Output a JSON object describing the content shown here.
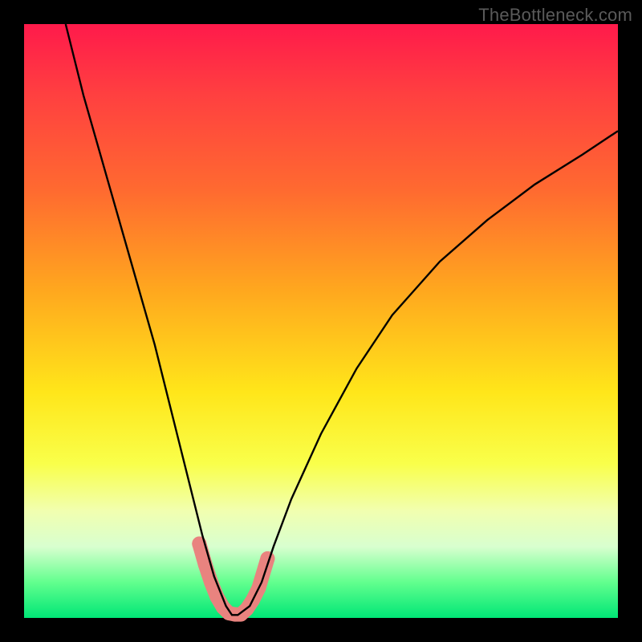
{
  "watermark": "TheBottleneck.com",
  "chart_data": {
    "type": "line",
    "title": "",
    "xlabel": "",
    "ylabel": "",
    "xlim": [
      0,
      100
    ],
    "ylim": [
      0,
      100
    ],
    "series": [
      {
        "name": "bottleneck-curve",
        "x": [
          7,
          10,
          14,
          18,
          22,
          26,
          28,
          30,
          32,
          34,
          35,
          36,
          38,
          40,
          42,
          45,
          50,
          56,
          62,
          70,
          78,
          86,
          94,
          100
        ],
        "y": [
          100,
          88,
          74,
          60,
          46,
          30,
          22,
          14,
          7,
          2,
          0.5,
          0.5,
          2,
          6,
          12,
          20,
          31,
          42,
          51,
          60,
          67,
          73,
          78,
          82
        ]
      }
    ],
    "markers": {
      "name": "highlight-band",
      "color": "#e9837f",
      "points": [
        {
          "x": 29.5,
          "y": 12.5
        },
        {
          "x": 30.5,
          "y": 9
        },
        {
          "x": 31.5,
          "y": 6
        },
        {
          "x": 32.5,
          "y": 3.5
        },
        {
          "x": 33.5,
          "y": 1.8
        },
        {
          "x": 34.5,
          "y": 0.8
        },
        {
          "x": 35.5,
          "y": 0.6
        },
        {
          "x": 36.5,
          "y": 0.6
        },
        {
          "x": 37.5,
          "y": 1.5
        },
        {
          "x": 38.5,
          "y": 3
        },
        {
          "x": 39.5,
          "y": 5
        },
        {
          "x": 41.0,
          "y": 10
        }
      ]
    }
  }
}
